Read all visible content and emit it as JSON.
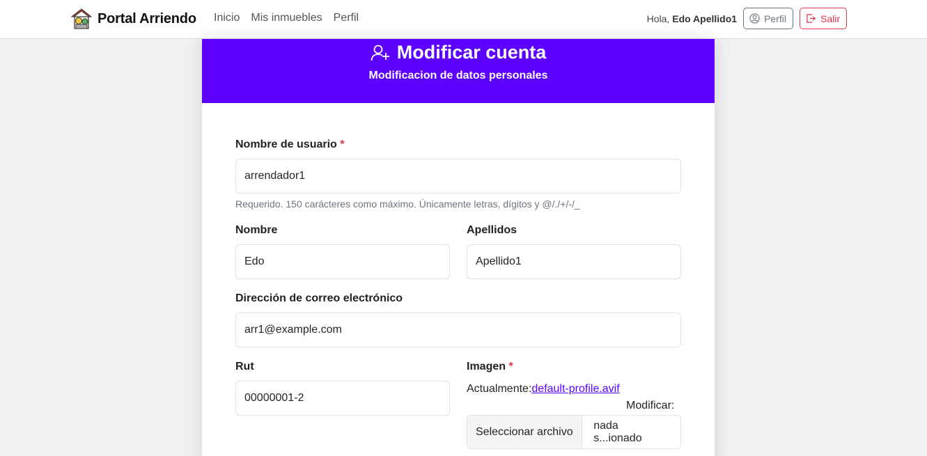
{
  "navbar": {
    "brand": "Portal Arriendo",
    "links": [
      "Inicio",
      "Mis inmuebles",
      "Perfil"
    ],
    "greeting_prefix": "Hola,",
    "user_name": "Edo Apellido1",
    "profile_button": "Perfil",
    "logout_button": "Salir"
  },
  "header": {
    "title": "Modificar cuenta",
    "subtitle": "Modificacion de datos personales"
  },
  "form": {
    "username": {
      "label": "Nombre de usuario",
      "required_mark": "*",
      "value": "arrendador1",
      "help": "Requerido. 150 carácteres como máximo. Únicamente letras, dígitos y @/./+/-/_"
    },
    "first_name": {
      "label": "Nombre",
      "value": "Edo"
    },
    "last_name": {
      "label": "Apellidos",
      "value": "Apellido1"
    },
    "email": {
      "label": "Dirección de correo electrónico",
      "value": "arr1@example.com"
    },
    "rut": {
      "label": "Rut",
      "value": "00000001-2"
    },
    "image": {
      "label": "Imagen",
      "required_mark": "*",
      "current_prefix": "Actualmente:",
      "current_file": "default-profile.avif",
      "modify_label": "Modificar:",
      "select_button": "Seleccionar archivo",
      "no_file": "nada s...ionado"
    }
  },
  "colors": {
    "accent": "#5c00ff",
    "danger": "#dc3545",
    "secondary": "#6c757d"
  },
  "icons": {
    "brand": "house-coin-icon",
    "profile": "person-circle-icon",
    "logout": "box-arrow-right-icon",
    "title": "person-add-icon"
  }
}
